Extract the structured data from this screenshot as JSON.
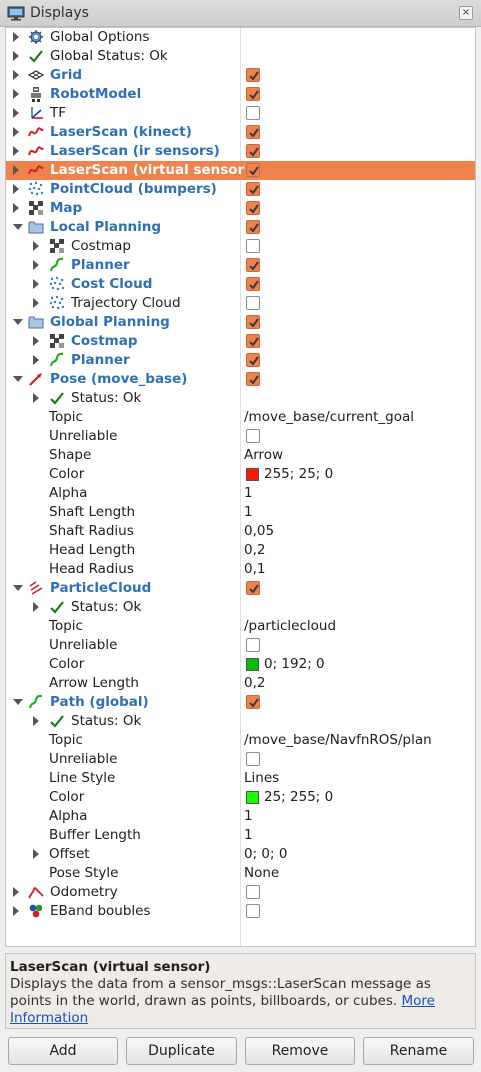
{
  "window": {
    "title": "Displays",
    "close_label": "×"
  },
  "rows": [
    {
      "name": "row-global-options",
      "label": "Global Options",
      "style": "plain",
      "indent": 0,
      "expander": "closed",
      "icon": "gear-icon"
    },
    {
      "name": "row-global-status",
      "label": "Global Status: Ok",
      "style": "plain",
      "indent": 0,
      "expander": "closed",
      "icon": "checkmark-icon"
    },
    {
      "name": "row-grid",
      "label": "Grid",
      "style": "bold",
      "indent": 0,
      "expander": "closed",
      "icon": "grid-icon",
      "checked": true
    },
    {
      "name": "row-robotmodel",
      "label": "RobotModel",
      "style": "bold",
      "indent": 0,
      "expander": "closed",
      "icon": "robot-model-icon",
      "checked": true
    },
    {
      "name": "row-tf",
      "label": "TF",
      "style": "plain",
      "indent": 0,
      "expander": "closed",
      "icon": "tf-axes-icon",
      "checked": false
    },
    {
      "name": "row-laserscan-kinect",
      "label": "LaserScan (kinect)",
      "style": "bold",
      "indent": 0,
      "expander": "closed",
      "icon": "laserscan-icon",
      "checked": true
    },
    {
      "name": "row-laserscan-ir",
      "label": "LaserScan (ir sensors)",
      "style": "bold",
      "indent": 0,
      "expander": "closed",
      "icon": "laserscan-icon",
      "checked": true
    },
    {
      "name": "row-laserscan-virtual",
      "label": "LaserScan (virtual sensor)",
      "style": "bold",
      "indent": 0,
      "expander": "closed",
      "icon": "laserscan-icon",
      "checked": true,
      "selected": true
    },
    {
      "name": "row-pointcloud-bumpers",
      "label": "PointCloud (bumpers)",
      "style": "bold",
      "indent": 0,
      "expander": "closed",
      "icon": "pointcloud-icon",
      "checked": true
    },
    {
      "name": "row-map",
      "label": "Map",
      "style": "bold",
      "indent": 0,
      "expander": "closed",
      "icon": "map-icon",
      "checked": true
    },
    {
      "name": "row-local-planning",
      "label": "Local Planning",
      "style": "bold",
      "indent": 0,
      "expander": "open",
      "icon": "folder-icon",
      "checked": true
    },
    {
      "name": "row-local-costmap",
      "label": "Costmap",
      "style": "plain",
      "indent": 1,
      "expander": "closed",
      "icon": "map-icon",
      "checked": false
    },
    {
      "name": "row-local-planner",
      "label": "Planner",
      "style": "bold",
      "indent": 1,
      "expander": "closed",
      "icon": "path-icon",
      "checked": true
    },
    {
      "name": "row-cost-cloud",
      "label": "Cost Cloud",
      "style": "bold",
      "indent": 1,
      "expander": "closed",
      "icon": "pointcloud-icon",
      "checked": true
    },
    {
      "name": "row-trajectory-cloud",
      "label": "Trajectory Cloud",
      "style": "plain",
      "indent": 1,
      "expander": "closed",
      "icon": "pointcloud-icon",
      "checked": false
    },
    {
      "name": "row-global-planning",
      "label": "Global Planning",
      "style": "bold",
      "indent": 0,
      "expander": "open",
      "icon": "folder-icon",
      "checked": true
    },
    {
      "name": "row-global-costmap",
      "label": "Costmap",
      "style": "bold",
      "indent": 1,
      "expander": "closed",
      "icon": "map-icon",
      "checked": true
    },
    {
      "name": "row-global-planner",
      "label": "Planner",
      "style": "bold",
      "indent": 1,
      "expander": "closed",
      "icon": "path-icon",
      "checked": true
    },
    {
      "name": "row-pose",
      "label": "Pose (move_base)",
      "style": "bold",
      "indent": 0,
      "expander": "open",
      "icon": "pose-arrow-icon",
      "checked": true
    },
    {
      "name": "row-pose-status",
      "label": "Status: Ok",
      "style": "plain",
      "indent": 1,
      "expander": "closed",
      "icon": "checkmark-icon"
    },
    {
      "name": "prop-pose-topic",
      "label": "Topic",
      "style": "plain",
      "indent": 1,
      "value": "/move_base/current_goal"
    },
    {
      "name": "prop-pose-unreliable",
      "label": "Unreliable",
      "style": "plain",
      "indent": 1,
      "checked": false
    },
    {
      "name": "prop-pose-shape",
      "label": "Shape",
      "style": "plain",
      "indent": 1,
      "value": "Arrow"
    },
    {
      "name": "prop-pose-color",
      "label": "Color",
      "style": "plain",
      "indent": 1,
      "value": "255; 25; 0",
      "swatch": "#ff1900"
    },
    {
      "name": "prop-pose-alpha",
      "label": "Alpha",
      "style": "plain",
      "indent": 1,
      "value": "1"
    },
    {
      "name": "prop-pose-shaft-length",
      "label": "Shaft Length",
      "style": "plain",
      "indent": 1,
      "value": "1"
    },
    {
      "name": "prop-pose-shaft-radius",
      "label": "Shaft Radius",
      "style": "plain",
      "indent": 1,
      "value": "0,05"
    },
    {
      "name": "prop-pose-head-length",
      "label": "Head Length",
      "style": "plain",
      "indent": 1,
      "value": "0,2"
    },
    {
      "name": "prop-pose-head-radius",
      "label": "Head Radius",
      "style": "plain",
      "indent": 1,
      "value": "0,1"
    },
    {
      "name": "row-particlecloud",
      "label": "ParticleCloud",
      "style": "bold",
      "indent": 0,
      "expander": "open",
      "icon": "particlecloud-icon",
      "checked": true
    },
    {
      "name": "row-particlecloud-status",
      "label": "Status: Ok",
      "style": "plain",
      "indent": 1,
      "expander": "closed",
      "icon": "checkmark-icon"
    },
    {
      "name": "prop-particlecloud-topic",
      "label": "Topic",
      "style": "plain",
      "indent": 1,
      "value": "/particlecloud"
    },
    {
      "name": "prop-particlecloud-unreliable",
      "label": "Unreliable",
      "style": "plain",
      "indent": 1,
      "checked": false
    },
    {
      "name": "prop-particlecloud-color",
      "label": "Color",
      "style": "plain",
      "indent": 1,
      "value": "0; 192; 0",
      "swatch": "#00c000"
    },
    {
      "name": "prop-particlecloud-arrow-length",
      "label": "Arrow Length",
      "style": "plain",
      "indent": 1,
      "value": "0,2"
    },
    {
      "name": "row-path-global",
      "label": "Path (global)",
      "style": "bold",
      "indent": 0,
      "expander": "open",
      "icon": "path-icon",
      "checked": true
    },
    {
      "name": "row-path-status",
      "label": "Status: Ok",
      "style": "plain",
      "indent": 1,
      "expander": "closed",
      "icon": "checkmark-icon"
    },
    {
      "name": "prop-path-topic",
      "label": "Topic",
      "style": "plain",
      "indent": 1,
      "value": "/move_base/NavfnROS/plan"
    },
    {
      "name": "prop-path-unreliable",
      "label": "Unreliable",
      "style": "plain",
      "indent": 1,
      "checked": false
    },
    {
      "name": "prop-path-line-style",
      "label": "Line Style",
      "style": "plain",
      "indent": 1,
      "value": "Lines"
    },
    {
      "name": "prop-path-color",
      "label": "Color",
      "style": "plain",
      "indent": 1,
      "value": "25; 255; 0",
      "swatch": "#19ff00"
    },
    {
      "name": "prop-path-alpha",
      "label": "Alpha",
      "style": "plain",
      "indent": 1,
      "value": "1"
    },
    {
      "name": "prop-path-buffer-length",
      "label": "Buffer Length",
      "style": "plain",
      "indent": 1,
      "value": "1"
    },
    {
      "name": "prop-path-offset",
      "label": "Offset",
      "style": "plain",
      "indent": 1,
      "expander": "closed",
      "value": "0; 0; 0"
    },
    {
      "name": "prop-path-pose-style",
      "label": "Pose Style",
      "style": "plain",
      "indent": 1,
      "value": "None"
    },
    {
      "name": "row-odometry",
      "label": "Odometry",
      "style": "plain",
      "indent": 0,
      "expander": "closed",
      "icon": "odometry-icon",
      "checked": false
    },
    {
      "name": "row-eband-boubles",
      "label": "EBand boubles",
      "style": "plain",
      "indent": 0,
      "expander": "closed",
      "icon": "marker-array-icon",
      "checked": false
    }
  ],
  "description": {
    "title": "LaserScan (virtual sensor)",
    "text": "Displays the data from a sensor_msgs::LaserScan message as points in the world, drawn as points, billboards, or cubes.",
    "link_text": "More Information"
  },
  "buttons": {
    "add": "Add",
    "duplicate": "Duplicate",
    "remove": "Remove",
    "rename": "Rename"
  },
  "colors": {
    "selection": "#f0834d",
    "display_name": "#2f6fb5",
    "checkbox_checked": "#f0834d"
  }
}
